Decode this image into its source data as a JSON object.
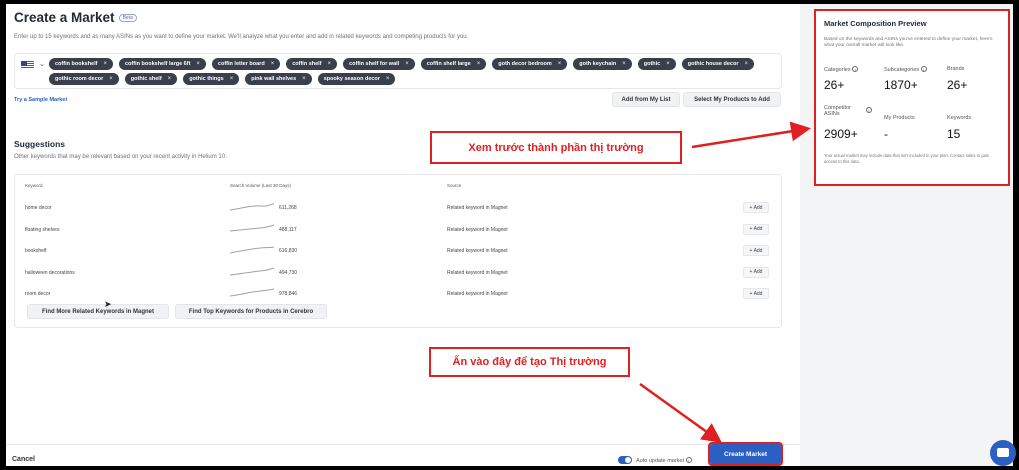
{
  "header": {
    "title": "Create a Market",
    "badge": "Beta",
    "intro": "Enter up to 15 keywords and as many ASINs as you want to define your market. We'll analyze what you enter and add in related keywords and competing products for you."
  },
  "keywords": [
    "coffin bookshelf",
    "coffin bookshelf large 6ft",
    "coffin letter board",
    "coffin shelf",
    "coffin shelf for wall",
    "coffin shelf large",
    "goth decor bedroom",
    "goth keychain",
    "gothic",
    "gothic house decor",
    "gothic room decor",
    "gothic shelf",
    "gothic things",
    "pink wall shelves",
    "spooky season decor"
  ],
  "actions": {
    "sample": "Try a Sample Market",
    "from_list": "Add from My List",
    "select_products": "Select My Products to Add"
  },
  "suggestions": {
    "title": "Suggestions",
    "desc": "Other keywords that may be relevant based on your recent activity in Helium 10.",
    "columns": {
      "keyword": "Keyword",
      "volume": "Search Volume (Last 30 Days)",
      "source": "Source"
    },
    "rows": [
      {
        "keyword": "home decor",
        "volume": "611,268",
        "source": "Related keyword in Magnet",
        "add": "+ Add"
      },
      {
        "keyword": "floating shelves",
        "volume": "488,117",
        "source": "Related keyword in Magnet",
        "add": "+ Add"
      },
      {
        "keyword": "bookshelf",
        "volume": "616,830",
        "source": "Related keyword in Magnet",
        "add": "+ Add"
      },
      {
        "keyword": "halloween decorations",
        "volume": "494,730",
        "source": "Related keyword in Magnet",
        "add": "+ Add"
      },
      {
        "keyword": "room decor",
        "volume": "978,846",
        "source": "Related keyword in Magnet",
        "add": "+ Add"
      }
    ],
    "more_magnet": "Find More Related Keywords in Magnet",
    "top_cerebro": "Find Top Keywords for Products in Cerebro"
  },
  "footer": {
    "cancel": "Cancel",
    "auto_update": "Auto update market",
    "create": "Create Market"
  },
  "preview": {
    "title": "Market Composition Preview",
    "desc": "Based on the keywords and ASINs you've entered to define your market, here's what your overall market will look like.",
    "stats": [
      {
        "label": "Categories",
        "value": "26+"
      },
      {
        "label": "Subcategories",
        "value": "1870+"
      },
      {
        "label": "Brands",
        "value": "26+"
      },
      {
        "label": "Competitor ASINs",
        "value": "2909+"
      },
      {
        "label": "My Products",
        "value": "-"
      },
      {
        "label": "Keywords",
        "value": "15"
      }
    ],
    "note": "Your actual market may include data that isn't included in your plan. Contact sales to gain access to this data."
  },
  "annotations": {
    "preview_callout": "Xem trước thành phần thị trường",
    "create_callout": "Ấn vào đây để tạo Thị trường"
  },
  "colors": {
    "accent": "#2b5fc4",
    "annotation": "#e02020",
    "chip": "#3a3f4c"
  }
}
